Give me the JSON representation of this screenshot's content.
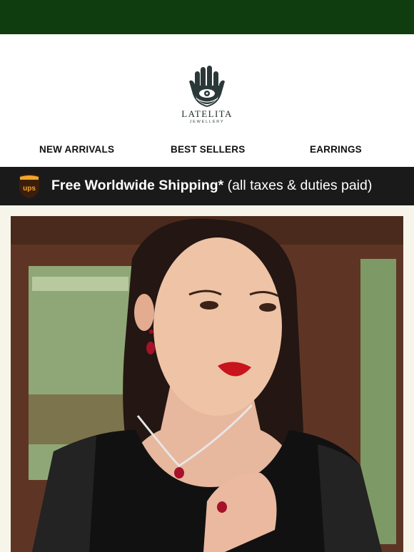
{
  "brand": {
    "name": "LATELITA",
    "tagline": "JEWELLERY"
  },
  "nav": [
    {
      "label": "NEW ARRIVALS"
    },
    {
      "label": "BEST SELLERS"
    },
    {
      "label": "EARRINGS"
    }
  ],
  "shipping": {
    "icon": "ups-logo-icon",
    "bold": "Free Worldwide Shipping*",
    "rest": "(all taxes & duties paid)"
  },
  "colors": {
    "header_bar": "#0f3d10",
    "shipping_bar": "#1a1a1a",
    "hero_frame": "#f7f5ea",
    "ups_brown": "#3b1e0a",
    "ups_gold": "#f2a52d"
  },
  "hero": {
    "image": "model-wearing-ruby-jewellery-photo"
  }
}
